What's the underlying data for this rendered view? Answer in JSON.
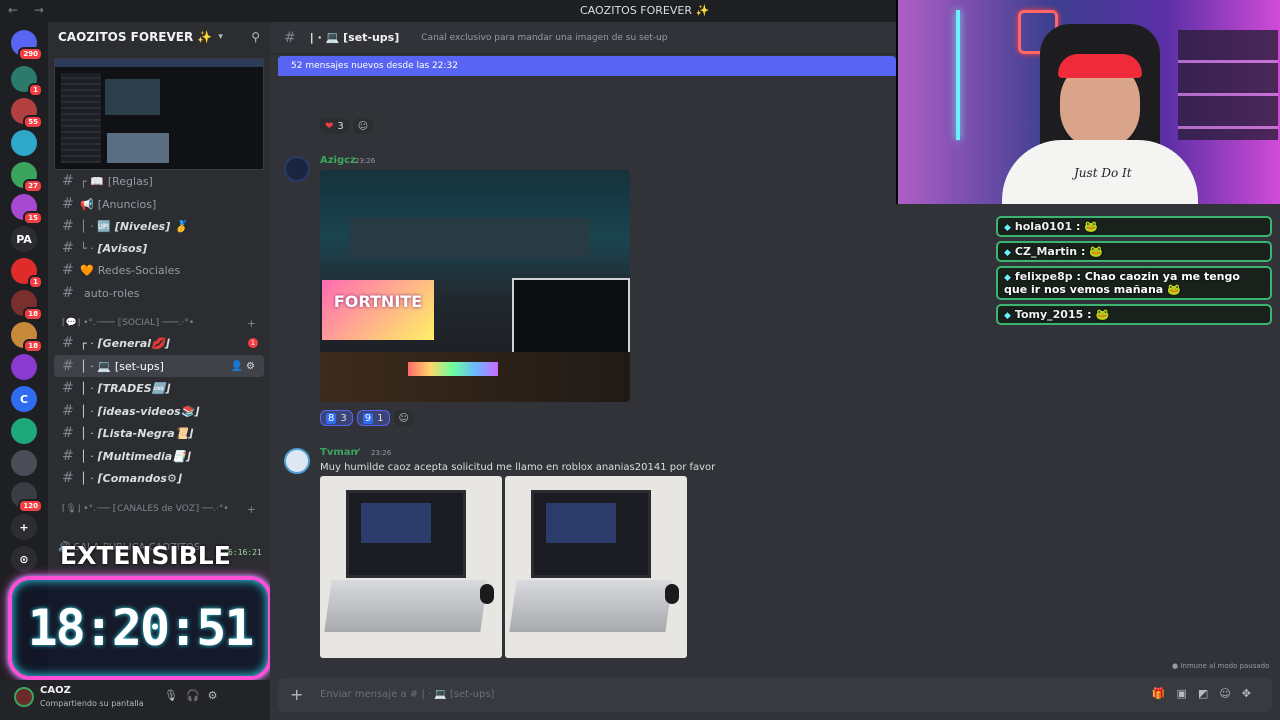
{
  "app": {
    "window_title": "CAOZITOS FOREVER ✨",
    "nav_arrows": "← →"
  },
  "colors": {
    "accent": "#5865f2",
    "online": "#3ba55d",
    "danger": "#f23f43",
    "clock_glow": "#ff4fd8",
    "clock_inner": "#2ee5ff"
  },
  "rail": {
    "servers": [
      {
        "label": "",
        "badge": "290",
        "color": "#5865f2"
      },
      {
        "label": "",
        "badge": "1",
        "color": "#2b7a6b"
      },
      {
        "label": "",
        "badge": "55",
        "color": "#b34040"
      },
      {
        "label": "",
        "badge": "",
        "color": "#2fa7c9"
      },
      {
        "label": "",
        "badge": "27",
        "color": "#3ba55d"
      },
      {
        "label": "",
        "badge": "15",
        "color": "#a64bd0"
      },
      {
        "label": "PA",
        "badge": "",
        "color": "#2b2d31"
      },
      {
        "label": "",
        "badge": "1",
        "color": "#e02b2b"
      },
      {
        "label": "",
        "badge": "18",
        "color": "#7a2f2f"
      },
      {
        "label": "",
        "badge": "18",
        "color": "#c78a3a"
      },
      {
        "label": "",
        "badge": "",
        "color": "#8a3ad0"
      },
      {
        "label": "C",
        "badge": "",
        "color": "#2f6cf2"
      },
      {
        "label": "",
        "badge": "",
        "color": "#1fa87a"
      },
      {
        "label": "",
        "badge": "",
        "color": "#4a4d55"
      },
      {
        "label": "",
        "badge": "120",
        "color": "#3a3d44"
      },
      {
        "label": "+",
        "badge": "",
        "color": "#2b2d31"
      },
      {
        "label": "⊙",
        "badge": "",
        "color": "#2b2d31"
      }
    ]
  },
  "sidebar": {
    "server_name": "CAOZITOS FOREVER ✨",
    "channels": [
      {
        "prefix": "┌ 📖",
        "name": "[Reglas]",
        "style": "plain"
      },
      {
        "prefix": "📢",
        "name": "[Anuncios]",
        "style": "plain"
      },
      {
        "prefix": "│ · 🆙",
        "name": "[Niveles] 🥇",
        "style": "bold"
      },
      {
        "prefix": "└ ·",
        "name": "[Avisos]",
        "style": "bold"
      },
      {
        "prefix": "🧡",
        "name": "Redes-Sociales",
        "style": "plain"
      },
      {
        "prefix": "",
        "name": "auto-roles",
        "style": "plain"
      }
    ],
    "category_social": "⌈💬⌋ •°.·─── ⟦SOCIAL⟧ ───.·°•",
    "social_channels": [
      {
        "prefix": "┌ ·",
        "name": "⌈General💋⌋",
        "badge": "1"
      },
      {
        "prefix": "│ · 💻",
        "name": "[set-ups]",
        "active": "true"
      },
      {
        "prefix": "│ ·",
        "name": "⌈TRADES🆒⌋"
      },
      {
        "prefix": "│ ·",
        "name": "⌈ideas-videos📚⌋"
      },
      {
        "prefix": "│ ·",
        "name": "⌈Lista-Negra📜⌋"
      },
      {
        "prefix": "│ ·",
        "name": "⌈Multimedia📑⌋"
      },
      {
        "prefix": "│ ·",
        "name": "⌈Comandos⚙⌋"
      }
    ],
    "category_voice": "⌈🎙⌋ •°.·── ⟦CANALES de VOZ⟧ ──.·°•",
    "voice_channel": "SALA PUBLICA CAOZITOS"
  },
  "overlay": {
    "extensible": "EXTENSIBLE",
    "extensible_time": "6:16:21",
    "clock": "18:20:51"
  },
  "user": {
    "name": "CAOZ",
    "status": "Compartiendo su pantalla"
  },
  "main": {
    "channel_name": "| · 💻 [set-ups]",
    "topic": "Canal exclusivo para mandar una imagen de su set-up",
    "new_messages": "52 mensajes nuevos desde las 22:32",
    "reactions_top": [
      {
        "emoji": "❤",
        "count": "3"
      }
    ],
    "messages": [
      {
        "author": "Azigcz",
        "time": "23:26",
        "author_color": "#3ba55d",
        "text": ""
      },
      {
        "author": "Tvman",
        "time": "23:26",
        "author_color": "#3ba55d",
        "text": "Muy humilde caoz acepta solicitud me llamo en roblox ananias20141 por favor"
      }
    ],
    "image1_poster": "FORTNITE",
    "reactions_mid": [
      {
        "emoji": "8",
        "count": "3"
      },
      {
        "emoji": "9",
        "count": "1"
      }
    ],
    "composer_placeholder": "Enviar mensaje a # | · 💻 [set-ups]",
    "immune_text": "● Inmune al modo pausado"
  },
  "webcam": {
    "shirt_text": "Just Do It"
  },
  "chat": [
    {
      "user": "hola0101",
      "text": ":",
      "emote": "🐸"
    },
    {
      "user": "CZ_Martin",
      "text": ":",
      "emote": "🐸"
    },
    {
      "user": "felixpe8p",
      "text": ": Chao caozin ya me tengo que ir nos vemos mañana",
      "emote": "🐸"
    },
    {
      "user": "Tomy_2015",
      "text": ":",
      "emote": "🐸"
    }
  ]
}
